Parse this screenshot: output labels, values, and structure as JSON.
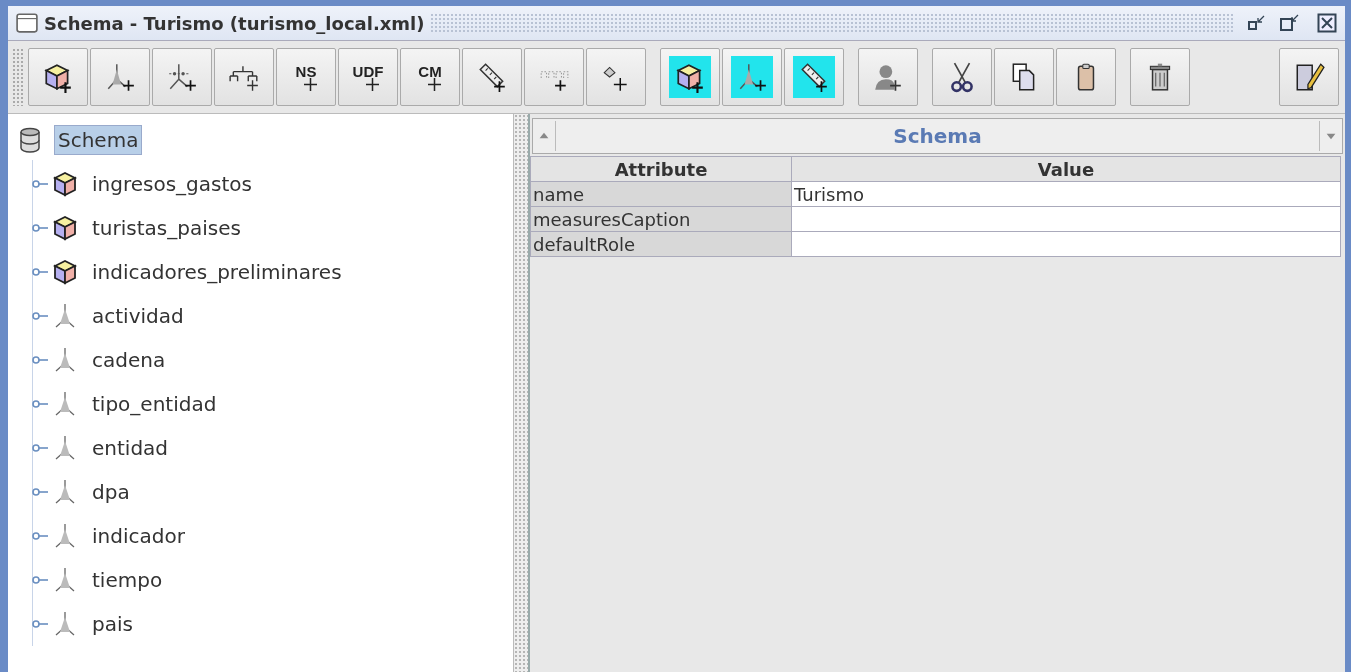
{
  "window": {
    "title": "Schema - Turismo (turismo_local.xml)"
  },
  "toolbar": [
    [
      {
        "kind": "cube",
        "highlighted": false
      },
      {
        "kind": "dimension",
        "highlighted": false
      },
      {
        "kind": "dimension-usage",
        "highlighted": false
      },
      {
        "kind": "hierarchy",
        "highlighted": false
      },
      {
        "kind": "text",
        "label": "NS",
        "highlighted": false
      },
      {
        "kind": "text",
        "label": "UDF",
        "highlighted": false
      },
      {
        "kind": "text",
        "label": "CM",
        "highlighted": false
      },
      {
        "kind": "measure",
        "highlighted": false
      },
      {
        "kind": "level",
        "highlighted": false
      },
      {
        "kind": "property",
        "highlighted": false
      }
    ],
    [
      {
        "kind": "cube",
        "highlighted": true
      },
      {
        "kind": "dimension",
        "highlighted": true
      },
      {
        "kind": "measure",
        "highlighted": true
      }
    ],
    [
      {
        "kind": "role",
        "highlighted": false
      }
    ],
    [
      {
        "kind": "cut",
        "highlighted": false
      },
      {
        "kind": "copy",
        "highlighted": false
      },
      {
        "kind": "paste",
        "highlighted": false
      }
    ],
    [
      {
        "kind": "delete",
        "highlighted": false
      }
    ],
    [
      {
        "kind": "edit",
        "highlighted": false
      }
    ]
  ],
  "tree": {
    "label": "Schema",
    "selected": true,
    "children": [
      {
        "kind": "cube",
        "label": "ingresos_gastos",
        "expanded": false
      },
      {
        "kind": "cube",
        "label": "turistas_paises",
        "expanded": false
      },
      {
        "kind": "cube",
        "label": "indicadores_preliminares",
        "expanded": false
      },
      {
        "kind": "dimension",
        "label": "actividad",
        "expanded": false
      },
      {
        "kind": "dimension",
        "label": "cadena",
        "expanded": false
      },
      {
        "kind": "dimension",
        "label": "tipo_entidad",
        "expanded": false
      },
      {
        "kind": "dimension",
        "label": "entidad",
        "expanded": false
      },
      {
        "kind": "dimension",
        "label": "dpa",
        "expanded": false
      },
      {
        "kind": "dimension",
        "label": "indicador",
        "expanded": false
      },
      {
        "kind": "dimension",
        "label": "tiempo",
        "expanded": false
      },
      {
        "kind": "dimension",
        "label": "pais",
        "expanded": false
      }
    ]
  },
  "properties": {
    "title": "Schema",
    "columns": [
      "Attribute",
      "Value"
    ],
    "rows": [
      {
        "attribute": "name",
        "value": "Turismo"
      },
      {
        "attribute": "measuresCaption"
      },
      {
        "attribute": "defaultRole"
      }
    ]
  }
}
